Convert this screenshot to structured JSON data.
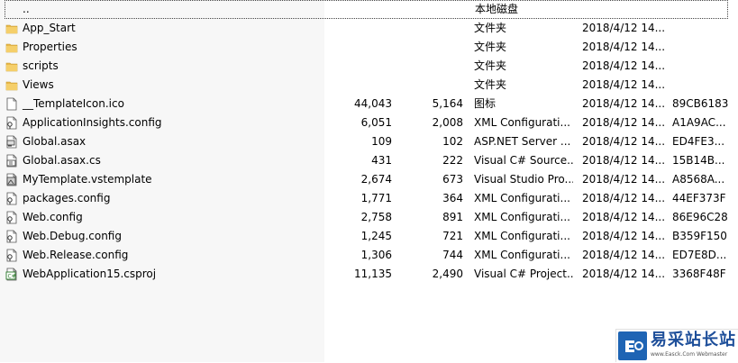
{
  "parent_row": {
    "name": "..",
    "type": "本地磁盘"
  },
  "folders": [
    {
      "name": "App_Start",
      "type": "文件夹",
      "modified": "2018/4/12 14..."
    },
    {
      "name": "Properties",
      "type": "文件夹",
      "modified": "2018/4/12 14..."
    },
    {
      "name": "scripts",
      "type": "文件夹",
      "modified": "2018/4/12 14..."
    },
    {
      "name": "Views",
      "type": "文件夹",
      "modified": "2018/4/12 14..."
    }
  ],
  "files": [
    {
      "name": "__TemplateIcon.ico",
      "size": "44,043",
      "packed": "5,164",
      "type": "图标",
      "modified": "2018/4/12 14...",
      "crc": "89CB6183",
      "icon": "blank-file-icon"
    },
    {
      "name": "ApplicationInsights.config",
      "size": "6,051",
      "packed": "2,008",
      "type": "XML Configurati...",
      "modified": "2018/4/12 14...",
      "crc": "A1A9AC...",
      "icon": "config-file-icon"
    },
    {
      "name": "Global.asax",
      "size": "109",
      "packed": "102",
      "type": "ASP.NET Server ...",
      "modified": "2018/4/12 14...",
      "crc": "ED4FE3...",
      "icon": "asax-file-icon"
    },
    {
      "name": "Global.asax.cs",
      "size": "431",
      "packed": "222",
      "type": "Visual C# Source...",
      "modified": "2018/4/12 14...",
      "crc": "15B14B...",
      "icon": "csharp-file-icon"
    },
    {
      "name": "MyTemplate.vstemplate",
      "size": "2,674",
      "packed": "673",
      "type": "Visual Studio Pro...",
      "modified": "2018/4/12 14...",
      "crc": "A8568A...",
      "icon": "vstemplate-file-icon"
    },
    {
      "name": "packages.config",
      "size": "1,771",
      "packed": "364",
      "type": "XML Configurati...",
      "modified": "2018/4/12 14...",
      "crc": "44EF373F",
      "icon": "config-file-icon"
    },
    {
      "name": "Web.config",
      "size": "2,758",
      "packed": "891",
      "type": "XML Configurati...",
      "modified": "2018/4/12 14...",
      "crc": "86E96C28",
      "icon": "config-file-icon"
    },
    {
      "name": "Web.Debug.config",
      "size": "1,245",
      "packed": "721",
      "type": "XML Configurati...",
      "modified": "2018/4/12 14...",
      "crc": "B359F150",
      "icon": "config-file-icon"
    },
    {
      "name": "Web.Release.config",
      "size": "1,306",
      "packed": "744",
      "type": "XML Configurati...",
      "modified": "2018/4/12 14...",
      "crc": "ED7E8D...",
      "icon": "config-file-icon"
    },
    {
      "name": "WebApplication15.csproj",
      "size": "11,135",
      "packed": "2,490",
      "type": "Visual C# Project...",
      "modified": "2018/4/12 14...",
      "crc": "3368F48F",
      "icon": "csproj-file-icon"
    }
  ],
  "watermark": {
    "title": "易采站长站",
    "subtitle": "www.Easck.Com Webmaster"
  },
  "colors": {
    "folder": "#e8b84a",
    "list_bg": "#ffffff",
    "watermark_blue": "#1e64b4"
  }
}
